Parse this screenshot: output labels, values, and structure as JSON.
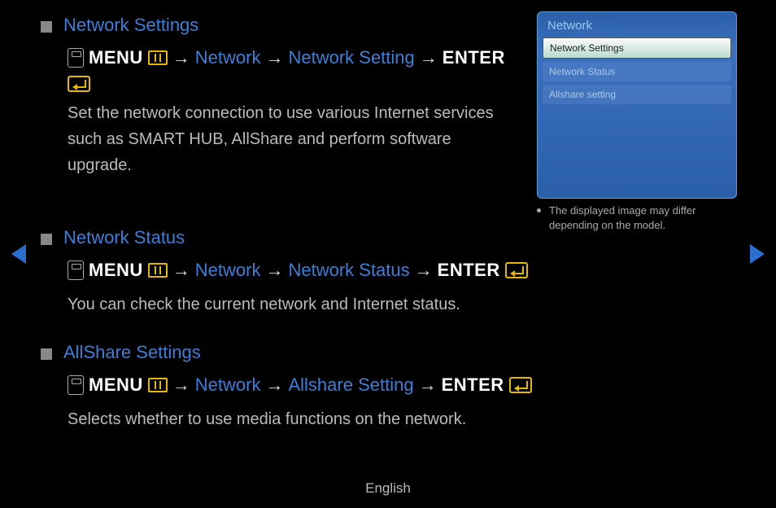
{
  "sections": [
    {
      "title": "Network Settings",
      "path": {
        "menu": "MENU",
        "step1": "Network",
        "step2": "Network Setting",
        "enter": "ENTER"
      },
      "desc": "Set the network connection to use various Internet services such as SMART HUB, AllShare and perform software upgrade."
    },
    {
      "title": "Network Status",
      "path": {
        "menu": "MENU",
        "step1": "Network",
        "step2": "Network Status",
        "enter": "ENTER"
      },
      "desc": "You can check the current network and Internet status."
    },
    {
      "title": "AllShare Settings",
      "path": {
        "menu": "MENU",
        "step1": "Network",
        "step2": "Allshare Setting",
        "enter": "ENTER"
      },
      "desc": "Selects whether to use media functions on the network."
    }
  ],
  "arrow": "→",
  "panel": {
    "title": "Network",
    "items": [
      "Network Settings",
      "Network Status",
      "Allshare setting"
    ],
    "selected_index": 0,
    "note": "The displayed image may differ depending on the model."
  },
  "footer": "English"
}
